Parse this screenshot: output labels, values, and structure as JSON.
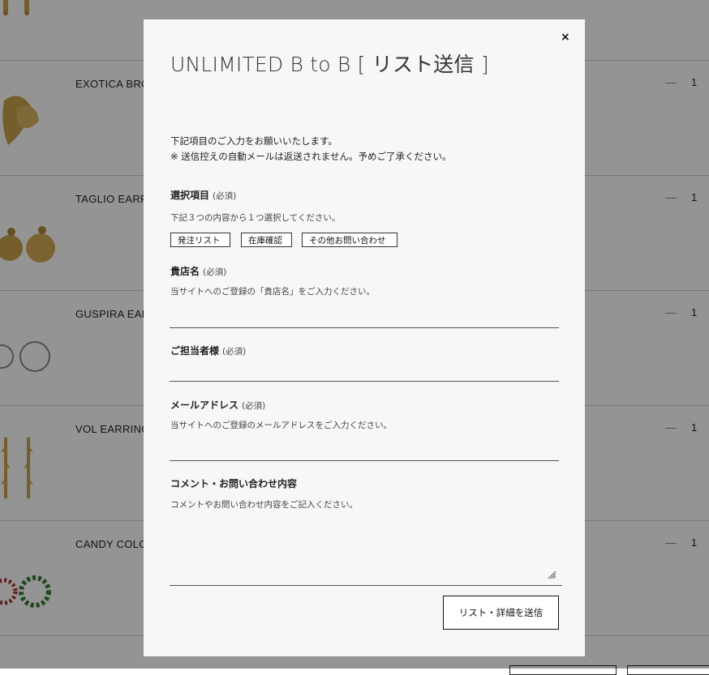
{
  "background": {
    "products": [
      {
        "name": "EXOTICA BRO",
        "qty": "1"
      },
      {
        "name": "TAGLIO EARR",
        "qty": "1"
      },
      {
        "name": "GUSPIRA EAR",
        "qty": "1"
      },
      {
        "name": "VOL EARRING",
        "qty": "1"
      },
      {
        "name": "CANDY COLOU",
        "qty": "1"
      }
    ]
  },
  "modal": {
    "close": "×",
    "title": "UNLIMITED B to B [ リスト送信 ]",
    "intro_line1": "下記項目のご入力をお願いいたします。",
    "intro_line2": "※ 送信控えの自動メールは返送されません。予めご了承ください。",
    "selection": {
      "label": "選択項目",
      "required": "(必須)",
      "help": "下記３つの内容から１つ選択してください。",
      "options": [
        "発注リスト",
        "在庫確認",
        "その他お問い合わせ"
      ]
    },
    "shop": {
      "label": "貴店名",
      "required": "(必須)",
      "help": "当サイトへのご登録の「貴店名」をご入力ください。",
      "value": ""
    },
    "person": {
      "label": "ご担当者様",
      "required": "(必須)",
      "value": ""
    },
    "email": {
      "label": "メールアドレス",
      "required": "(必須)",
      "help": "当サイトへのご登録のメールアドレスをご入力ください。",
      "value": ""
    },
    "comment": {
      "label": "コメント・お問い合わせ内容",
      "help": "コメントやお問い合わせ内容をご記入ください。",
      "value": ""
    },
    "submit": "リスト・詳細を送信"
  }
}
